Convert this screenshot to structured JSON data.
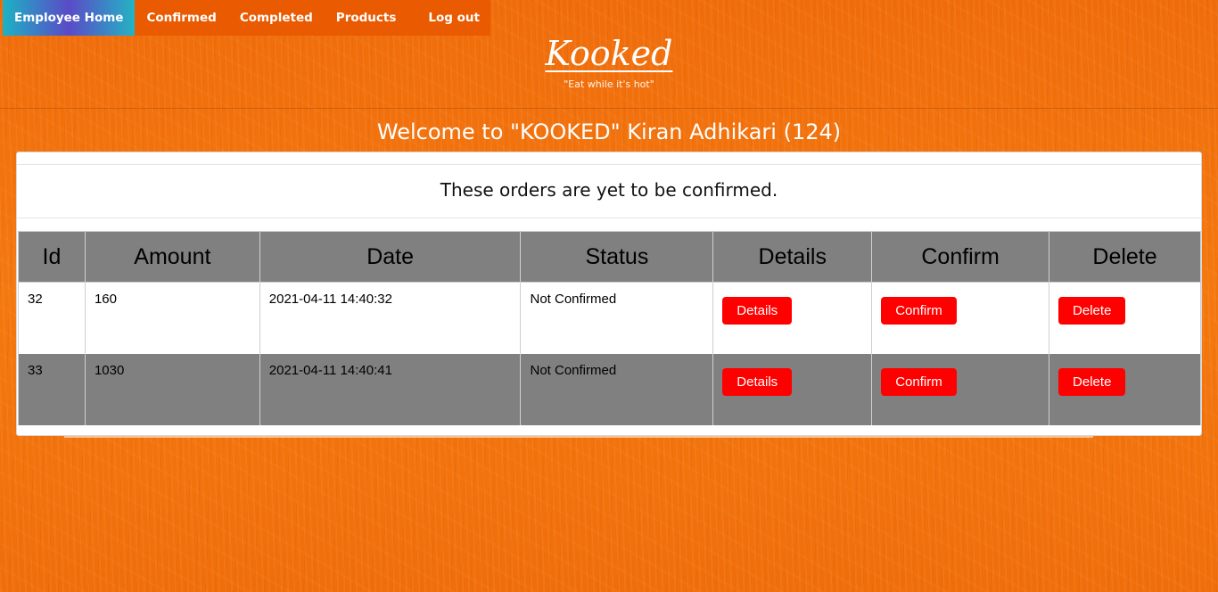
{
  "nav": {
    "items": [
      {
        "label": "Employee Home"
      },
      {
        "label": "Confirmed"
      },
      {
        "label": "Completed"
      },
      {
        "label": "Products"
      }
    ],
    "logout_label": "Log out"
  },
  "logo": {
    "title": "Kooked",
    "tagline": "\"Eat while it's hot\""
  },
  "welcome": "Welcome to \"KOOKED\" Kiran Adhikari (124)",
  "card": {
    "heading": "These orders are yet to be confirmed."
  },
  "table": {
    "headers": [
      "Id",
      "Amount",
      "Date",
      "Status",
      "Details",
      "Confirm",
      "Delete"
    ],
    "rows": [
      {
        "id": "32",
        "amount": "160",
        "date": "2021-04-11 14:40:32",
        "status": "Not Confirmed",
        "details_label": "Details",
        "confirm_label": "Confirm",
        "delete_label": "Delete"
      },
      {
        "id": "33",
        "amount": "1030",
        "date": "2021-04-11 14:40:41",
        "status": "Not Confirmed",
        "details_label": "Details",
        "confirm_label": "Confirm",
        "delete_label": "Delete"
      }
    ]
  },
  "colors": {
    "accent_orange": "#ea5a00",
    "button_red": "#ff0000",
    "header_grey": "#808080"
  }
}
